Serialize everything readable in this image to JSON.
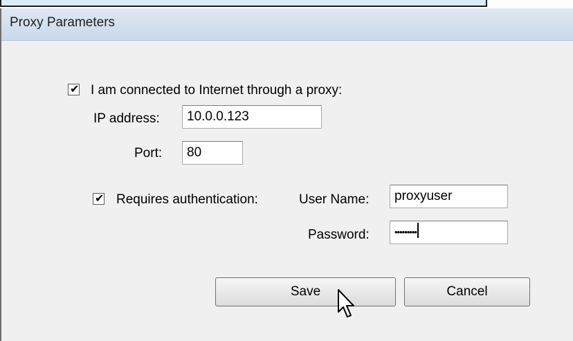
{
  "dialog": {
    "title": "Proxy Parameters"
  },
  "proxy": {
    "enabled_label": "I am connected to Internet through a proxy:",
    "enabled": true,
    "ip_label": "IP address:",
    "ip_value": "10.0.0.123",
    "port_label": "Port:",
    "port_value": "80"
  },
  "auth": {
    "requires_label": "Requires authentication:",
    "enabled": true,
    "username_label": "User Name:",
    "username_value": "proxyuser",
    "password_label": "Password:",
    "password_value": "•••••••••"
  },
  "buttons": {
    "save": "Save",
    "cancel": "Cancel"
  },
  "icons": {
    "checkmark": "checkmark-icon",
    "cursor": "mouse-pointer-icon"
  }
}
